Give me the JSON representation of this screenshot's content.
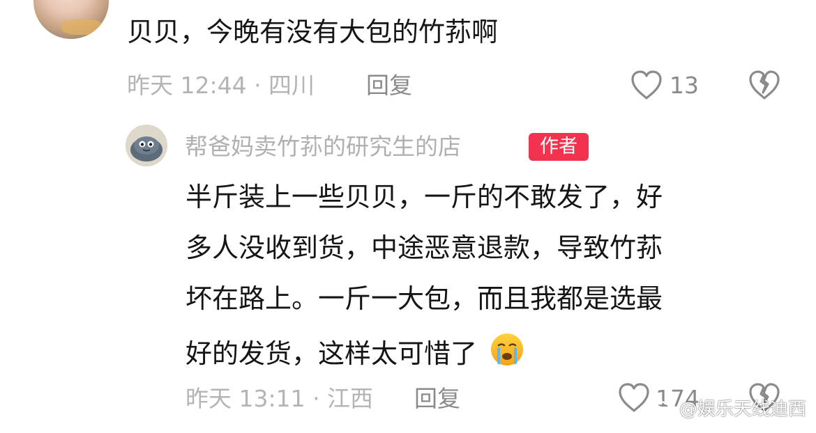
{
  "comment": {
    "text": "贝贝，今晚有没有大包的竹荪啊",
    "time_location": "昨天 12:44 · 四川",
    "reply_label": "回复",
    "like_count": "13"
  },
  "reply": {
    "author": "帮爸妈卖竹荪的研究生的店",
    "badge": "作者",
    "lines": [
      "半斤装上一些贝贝，一斤的不敢发了，好",
      "多人没收到货，中途恶意退款，导致竹荪",
      "坏在路上。一斤一大包，而且我都是选最",
      "好的发货，这样太可惜了"
    ],
    "emoji": "😭",
    "time_location": "昨天 13:11 · 江西",
    "reply_label": "回复",
    "like_count": "174"
  },
  "watermark": {
    "text": "@娱乐天线迪西"
  },
  "colors": {
    "badge": "#f2324f",
    "meta_text": "#b4b4b4",
    "action_text": "#8a8a8a"
  },
  "icons": [
    "heart-outline-icon",
    "broken-heart-icon",
    "weibo-logo-icon"
  ]
}
